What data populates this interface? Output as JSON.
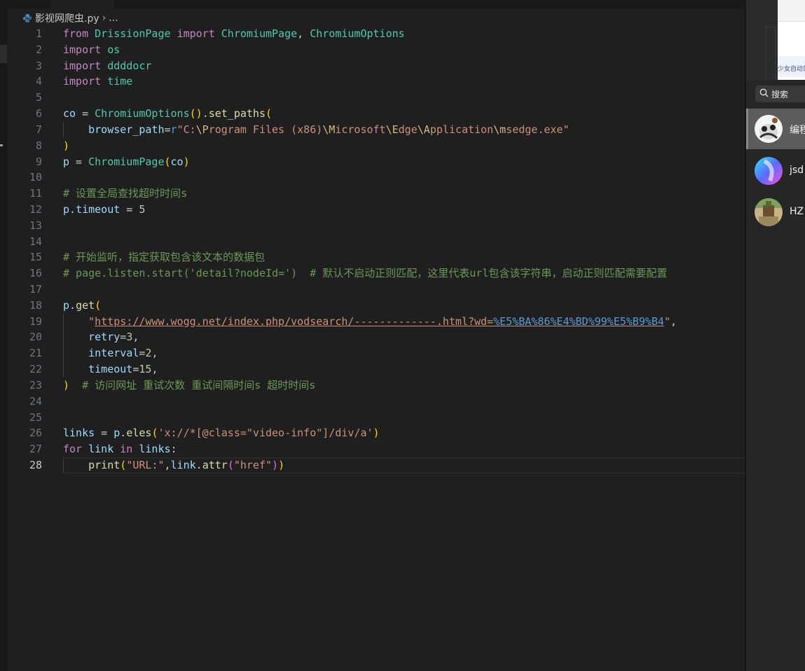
{
  "breadcrumb": {
    "file": "影视网爬虫.py",
    "separator": "›",
    "tail": "..."
  },
  "current_line": 28,
  "lines": [
    "1",
    "2",
    "3",
    "4",
    "5",
    "6",
    "7",
    "8",
    "9",
    "10",
    "11",
    "12",
    "13",
    "14",
    "15",
    "16",
    "17",
    "18",
    "19",
    "20",
    "21",
    "22",
    "23",
    "24",
    "25",
    "26",
    "27",
    "28"
  ],
  "code": {
    "l1": {
      "from": "from",
      "module": "DrissionPage",
      "import": "import",
      "name1": "ChromiumPage",
      "comma": ", ",
      "name2": "ChromiumOptions"
    },
    "l2": {
      "import": "import",
      "module": "os"
    },
    "l3": {
      "import": "import",
      "module": "ddddocr"
    },
    "l4": {
      "import": "import",
      "module": "time"
    },
    "l6": {
      "var": "co",
      "eq": " = ",
      "cls": "ChromiumOptions",
      "paren": "()",
      "dot": ".",
      "fn": "set_paths",
      "open": "("
    },
    "l7": {
      "param": "browser_path",
      "eq": "=",
      "prefix": "r",
      "s1": "\"C:",
      "e1": "\\P",
      "s2": "rogram Files (x86)",
      "e2": "\\M",
      "s3": "icrosoft",
      "e3": "\\E",
      "s4": "dge",
      "e4": "\\A",
      "s5": "pplication",
      "e5": "\\m",
      "s6": "sedge.exe\""
    },
    "l8": {
      "close": ")"
    },
    "l9": {
      "var": "p",
      "eq": " = ",
      "cls": "ChromiumPage",
      "open": "(",
      "arg": "co",
      "close": ")"
    },
    "l11": {
      "comment": "# 设置全局查找超时时间s"
    },
    "l12": {
      "obj": "p",
      "dot": ".",
      "attr": "timeout",
      "eq": " = ",
      "num": "5"
    },
    "l15": {
      "comment": "# 开始监听，指定获取包含该文本的数据包"
    },
    "l16": {
      "comment": "# page.listen.start('detail?nodeId=')  # 默认不启动正则匹配，这里代表url包含该字符串，启动正则匹配需要配置"
    },
    "l18": {
      "obj": "p",
      "dot": ".",
      "fn": "get",
      "open": "("
    },
    "l19": {
      "q": "\"",
      "url1": "https://www.wogg.net/index.php/vodsearch/-------------.html?wd=",
      "p1": "%E5",
      "u2": "",
      "p2": "%BA",
      "p3": "%86",
      "p4": "%E4",
      "p5": "%BD",
      "p6": "%99",
      "p7": "%E5",
      "p8": "%B9",
      "p9": "%B4",
      "q2": "\"",
      "comma": ","
    },
    "l20": {
      "param": "retry",
      "eq": "=",
      "num": "3",
      "comma": ","
    },
    "l21": {
      "param": "interval",
      "eq": "=",
      "num": "2",
      "comma": ","
    },
    "l22": {
      "param": "timeout",
      "eq": "=",
      "num": "15",
      "comma": ","
    },
    "l23": {
      "close": ")",
      "comment": "  # 访问网址 重试次数 重试间隔时间s 超时时间s"
    },
    "l26": {
      "var": "links",
      "eq": " = ",
      "obj": "p",
      "dot": ".",
      "fn": "eles",
      "open": "(",
      "str": "'x://*[@class=\"video-info\"]/div/a'",
      "close": ")"
    },
    "l27": {
      "for": "for",
      "var": "link",
      "in": "in",
      "iter": "links",
      "colon": ":"
    },
    "l28": {
      "fn": "print",
      "open": "(",
      "s1": "\"URL:\"",
      "comma": ",",
      "obj": "link",
      "dot": ".",
      "fn2": "attr",
      "open2": "(",
      "s2": "\"href\"",
      "close2": ")",
      "close": ")"
    }
  },
  "right_panel": {
    "browser_snippet": "少女自动菜",
    "search_placeholder": "搜索",
    "contacts": [
      {
        "name": "编程"
      },
      {
        "name": "jsd"
      },
      {
        "name": "HZ"
      }
    ]
  },
  "colors": {
    "editor_bg": "#1f1f1f",
    "keyword": "#c586c0",
    "class": "#4ec9b0",
    "function": "#dcdcaa",
    "variable": "#9cdcfe",
    "string": "#ce9178",
    "number": "#b5cea8",
    "comment": "#6a9955"
  }
}
